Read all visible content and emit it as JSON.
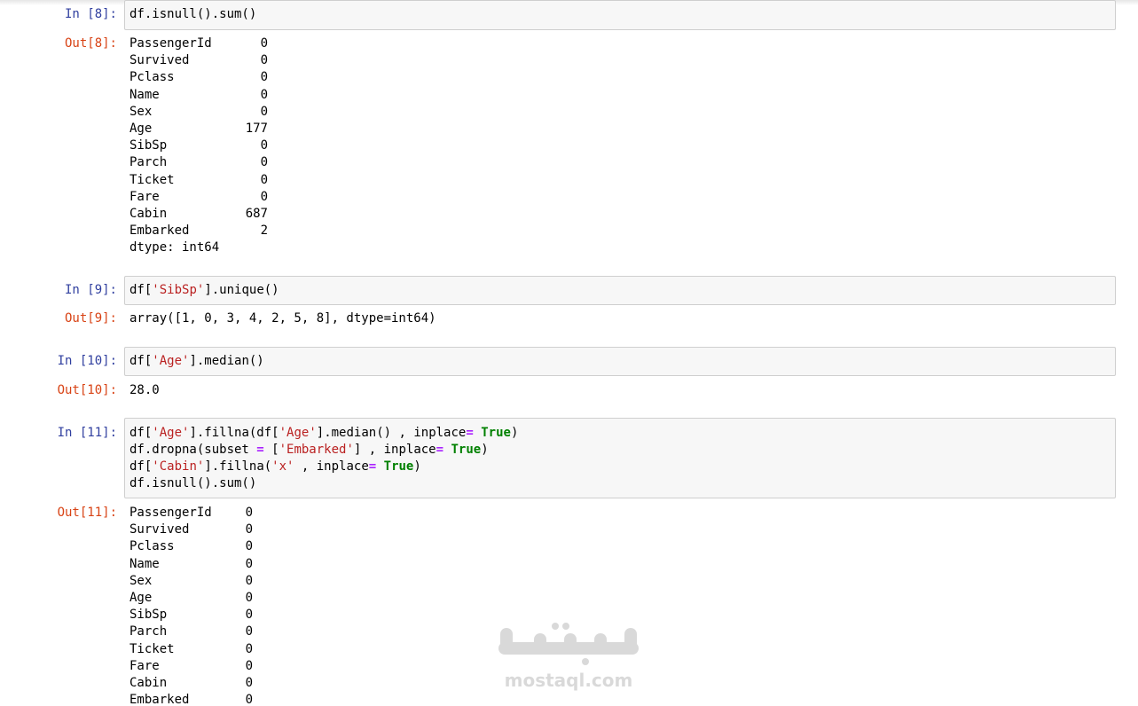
{
  "cells": {
    "c8": {
      "in_prompt": "In [8]:",
      "out_prompt": "Out[8]:",
      "code": "df.isnull().sum()",
      "series": [
        {
          "name": "PassengerId",
          "value": "0"
        },
        {
          "name": "Survived",
          "value": "0"
        },
        {
          "name": "Pclass",
          "value": "0"
        },
        {
          "name": "Name",
          "value": "0"
        },
        {
          "name": "Sex",
          "value": "0"
        },
        {
          "name": "Age",
          "value": "177"
        },
        {
          "name": "SibSp",
          "value": "0"
        },
        {
          "name": "Parch",
          "value": "0"
        },
        {
          "name": "Ticket",
          "value": "0"
        },
        {
          "name": "Fare",
          "value": "0"
        },
        {
          "name": "Cabin",
          "value": "687"
        },
        {
          "name": "Embarked",
          "value": "2"
        }
      ],
      "dtype": "dtype: int64"
    },
    "c9": {
      "in_prompt": "In [9]:",
      "out_prompt": "Out[9]:",
      "code_pre": "df[",
      "code_str": "'SibSp'",
      "code_post": "].unique()",
      "output": "array([1, 0, 3, 4, 2, 5, 8], dtype=int64)"
    },
    "c10": {
      "in_prompt": "In [10]:",
      "out_prompt": "Out[10]:",
      "code_pre": "df[",
      "code_str": "'Age'",
      "code_post": "].median()",
      "output": "28.0"
    },
    "c11": {
      "in_prompt": "In [11]:",
      "out_prompt": "Out[11]:",
      "l1": {
        "a": "df[",
        "s1": "'Age'",
        "b": "].fillna(df[",
        "s2": "'Age'",
        "c": "].median() , inplace",
        "op": "=",
        "sp": " ",
        "kw": "True",
        "d": ")"
      },
      "l2": {
        "a": "df.dropna(subset ",
        "op1": "=",
        "b": " [",
        "s1": "'Embarked'",
        "c": "] , inplace",
        "op2": "=",
        "sp": " ",
        "kw": "True",
        "d": ")"
      },
      "l3": {
        "a": "df[",
        "s1": "'Cabin'",
        "b": "].fillna(",
        "s2": "'x'",
        "c": " , inplace",
        "op": "=",
        "sp": " ",
        "kw": "True",
        "d": ")"
      },
      "l4": "df.isnull().sum()",
      "series": [
        {
          "name": "PassengerId",
          "value": "0"
        },
        {
          "name": "Survived",
          "value": "0"
        },
        {
          "name": "Pclass",
          "value": "0"
        },
        {
          "name": "Name",
          "value": "0"
        },
        {
          "name": "Sex",
          "value": "0"
        },
        {
          "name": "Age",
          "value": "0"
        },
        {
          "name": "SibSp",
          "value": "0"
        },
        {
          "name": "Parch",
          "value": "0"
        },
        {
          "name": "Ticket",
          "value": "0"
        },
        {
          "name": "Fare",
          "value": "0"
        },
        {
          "name": "Cabin",
          "value": "0"
        },
        {
          "name": "Embarked",
          "value": "0"
        }
      ]
    }
  },
  "watermark": {
    "text": "mostaql.com",
    "logo_text": "مستقل"
  },
  "colors": {
    "in_prompt": "#303f9f",
    "out_prompt": "#d84315",
    "string": "#ba2121",
    "keyword": "#008000",
    "operator": "#aa22ff",
    "input_bg": "#f7f7f7"
  }
}
